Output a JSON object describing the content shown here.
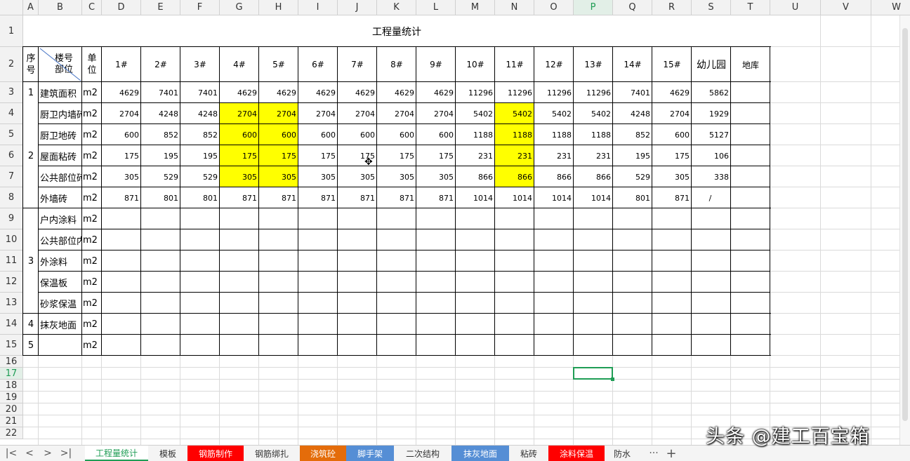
{
  "columns": [
    "A",
    "B",
    "C",
    "D",
    "E",
    "F",
    "G",
    "H",
    "I",
    "J",
    "K",
    "L",
    "M",
    "N",
    "O",
    "P",
    "Q",
    "R",
    "S",
    "T",
    "U",
    "V",
    "W"
  ],
  "rows": [
    "1",
    "2",
    "3",
    "4",
    "5",
    "6",
    "7",
    "8",
    "9",
    "10",
    "11",
    "12",
    "13",
    "14",
    "15",
    "16",
    "17",
    "18",
    "19",
    "20",
    "21",
    "22"
  ],
  "selected_column": "P",
  "selected_row": "17",
  "title": "工程量统计",
  "header": {
    "seq": "序号",
    "building": "楼号",
    "part": "部位",
    "unit": "单位",
    "buildings": [
      "1#",
      "2#",
      "3#",
      "4#",
      "5#",
      "6#",
      "7#",
      "8#",
      "9#",
      "10#",
      "11#",
      "12#",
      "13#",
      "14#",
      "15#",
      "幼儿园",
      "地库"
    ]
  },
  "group_numbers": [
    "1",
    "2",
    "3",
    "4",
    "5"
  ],
  "table_rows": [
    {
      "item": "建筑面积",
      "unit": "m2",
      "values": [
        "4629",
        "7401",
        "7401",
        "4629",
        "4629",
        "4629",
        "4629",
        "4629",
        "4629",
        "11296",
        "11296",
        "11296",
        "11296",
        "7401",
        "4629",
        "5862",
        ""
      ]
    },
    {
      "item": "厨卫内墙砖",
      "unit": "m2",
      "values": [
        "2704",
        "4248",
        "4248",
        "2704",
        "2704",
        "2704",
        "2704",
        "2704",
        "2704",
        "5402",
        "5402",
        "5402",
        "5402",
        "4248",
        "2704",
        "1929",
        ""
      ]
    },
    {
      "item": "厨卫地砖",
      "unit": "m2",
      "values": [
        "600",
        "852",
        "852",
        "600",
        "600",
        "600",
        "600",
        "600",
        "600",
        "1188",
        "1188",
        "1188",
        "1188",
        "852",
        "600",
        "5127",
        ""
      ]
    },
    {
      "item": "屋面粘砖",
      "unit": "m2",
      "values": [
        "175",
        "195",
        "195",
        "175",
        "175",
        "175",
        "175",
        "175",
        "175",
        "231",
        "231",
        "231",
        "231",
        "195",
        "175",
        "106",
        ""
      ]
    },
    {
      "item": "公共部位砖",
      "unit": "m2",
      "values": [
        "305",
        "529",
        "529",
        "305",
        "305",
        "305",
        "305",
        "305",
        "305",
        "866",
        "866",
        "866",
        "866",
        "529",
        "305",
        "338",
        ""
      ]
    },
    {
      "item": "外墙砖",
      "unit": "m2",
      "values": [
        "871",
        "801",
        "801",
        "871",
        "871",
        "871",
        "871",
        "871",
        "871",
        "1014",
        "1014",
        "1014",
        "1014",
        "801",
        "871",
        "/",
        ""
      ]
    },
    {
      "item": "户内涂料",
      "unit": "m2",
      "values": []
    },
    {
      "item": "公共部位内",
      "unit": "m2",
      "values": []
    },
    {
      "item": "外涂料",
      "unit": "m2",
      "values": []
    },
    {
      "item": "保温板",
      "unit": "m2",
      "values": []
    },
    {
      "item": "砂浆保温",
      "unit": "m2",
      "values": []
    },
    {
      "item": "抹灰地面",
      "unit": "m2",
      "values": []
    },
    {
      "item": "",
      "unit": "m2",
      "values": []
    }
  ],
  "highlight_color": "#ffff00",
  "sheet_nav": [
    "|<",
    "<",
    ">",
    ">|"
  ],
  "tabs": [
    {
      "label": "工程量统计",
      "color": "",
      "active": true
    },
    {
      "label": "模板",
      "color": "",
      "active": false
    },
    {
      "label": "钢筋制作",
      "color": "#ff0000",
      "active": false
    },
    {
      "label": "钢筋绑扎",
      "color": "",
      "active": false
    },
    {
      "label": "浇筑砼",
      "color": "#e46c0a",
      "active": false
    },
    {
      "label": "脚手架",
      "color": "#558ed5",
      "active": false
    },
    {
      "label": "二次结构",
      "color": "",
      "active": false
    },
    {
      "label": "抹灰地面",
      "color": "#558ed5",
      "active": false
    },
    {
      "label": "粘砖",
      "color": "",
      "active": false
    },
    {
      "label": "涂料保温",
      "color": "#ff0000",
      "active": false
    },
    {
      "label": "防水",
      "color": "",
      "active": false
    }
  ],
  "tabs_more": "···",
  "add_sheet": "+",
  "watermark": "头条 @建工百宝箱"
}
